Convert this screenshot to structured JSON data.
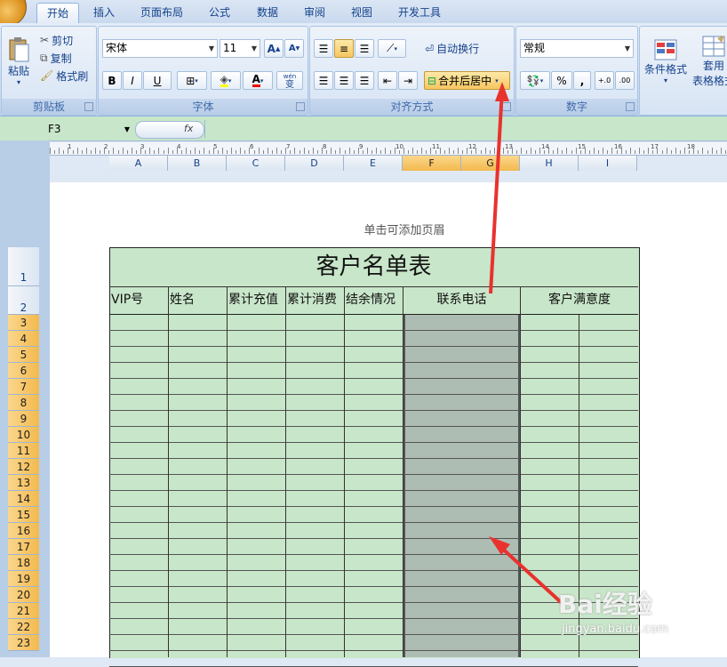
{
  "tabs": [
    "开始",
    "插入",
    "页面布局",
    "公式",
    "数据",
    "审阅",
    "视图",
    "开发工具"
  ],
  "active_tab": "开始",
  "clipboard": {
    "paste_label": "粘贴",
    "cut_label": "剪切",
    "copy_label": "复制",
    "format_painter_label": "格式刷",
    "group_label": "剪贴板"
  },
  "font": {
    "name": "宋体",
    "size": "11",
    "bold": "B",
    "italic": "I",
    "underline": "U",
    "group_label": "字体",
    "phonetic": "wén"
  },
  "alignment": {
    "wrap_label": "自动换行",
    "merge_label": "合并后居中",
    "group_label": "对齐方式"
  },
  "number": {
    "format": "常规",
    "percent": "%",
    "comma": ",",
    "group_label": "数字"
  },
  "styles": {
    "cond_format_label": "条件格式",
    "table_format_label_1": "套用",
    "table_format_label_2": "表格格式"
  },
  "formula_bar": {
    "name_box": "F3",
    "fx": "fx"
  },
  "ruler_numbers": [
    "1",
    "2",
    "3",
    "4",
    "5",
    "6",
    "7",
    "8",
    "9",
    "10",
    "11",
    "12",
    "13",
    "14",
    "15",
    "16",
    "17",
    "18"
  ],
  "columns": [
    "A",
    "B",
    "C",
    "D",
    "E",
    "F",
    "G",
    "H",
    "I"
  ],
  "selected_columns": [
    "F",
    "G"
  ],
  "rows": [
    "1",
    "2",
    "3",
    "4",
    "5",
    "6",
    "7",
    "8",
    "9",
    "10",
    "11",
    "12",
    "13",
    "14",
    "15",
    "16",
    "17",
    "18",
    "19",
    "20",
    "21",
    "22",
    "23"
  ],
  "page": {
    "header_hint": "单击可添加页眉"
  },
  "sheet": {
    "title": "客户名单表",
    "headers": [
      "VIP号",
      "姓名",
      "累计充值",
      "累计消费",
      "结余情况",
      "联系电话",
      "客户满意度"
    ]
  },
  "watermark": {
    "brand": "Bai经验",
    "url": "jingyan.baidu.com"
  },
  "colors": {
    "cell_fill": "#c8e6c9",
    "selection_fill": "#aebdb3",
    "arrow": "#e8322e",
    "highlight": "#f7c660"
  }
}
